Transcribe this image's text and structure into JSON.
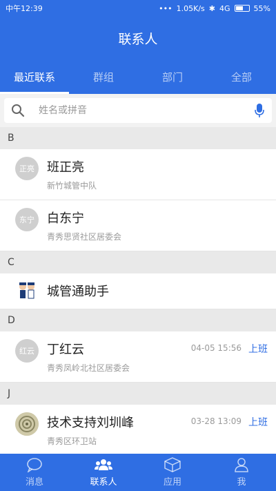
{
  "statusbar": {
    "time": "中午12:39",
    "network_speed": "1.05K/s",
    "network_type": "4G",
    "battery": "55%"
  },
  "header": {
    "title": "联系人",
    "tabs": [
      {
        "label": "最近联系",
        "active": true
      },
      {
        "label": "群组",
        "active": false
      },
      {
        "label": "部门",
        "active": false
      },
      {
        "label": "全部",
        "active": false
      }
    ]
  },
  "search": {
    "placeholder": "姓名或拼音",
    "search_icon": "search-icon",
    "mic_icon": "microphone-icon"
  },
  "sections": [
    {
      "letter": "B",
      "contacts": [
        {
          "avatar_text": "正亮",
          "name": "班正亮",
          "org": "新竹城管中队",
          "time": "",
          "status": ""
        },
        {
          "avatar_text": "东宁",
          "name": "白东宁",
          "org": "青秀思贤社区居委会",
          "time": "",
          "status": ""
        }
      ]
    },
    {
      "letter": "C",
      "contacts": [
        {
          "avatar_text": "",
          "name": "城管通助手",
          "org": "",
          "time": "",
          "status": ""
        }
      ]
    },
    {
      "letter": "D",
      "contacts": [
        {
          "avatar_text": "红云",
          "name": "丁红云",
          "org": "青秀凤岭北社区居委会",
          "time": "04-05 15:56",
          "status": "上班"
        }
      ]
    },
    {
      "letter": "J",
      "contacts": [
        {
          "avatar_text": "",
          "name": "技术支持刘圳峰",
          "org": "青秀区环卫站",
          "time": "03-28 13:09",
          "status": "上班"
        }
      ]
    }
  ],
  "bottom_nav": [
    {
      "label": "消息",
      "icon": "chat-bubble-icon",
      "active": false
    },
    {
      "label": "联系人",
      "icon": "contacts-icon",
      "active": true
    },
    {
      "label": "应用",
      "icon": "cube-icon",
      "active": false
    },
    {
      "label": "我",
      "icon": "person-icon",
      "active": false
    }
  ],
  "colors": {
    "primary": "#2f6ee3",
    "status_text": "#2f6ee3"
  }
}
